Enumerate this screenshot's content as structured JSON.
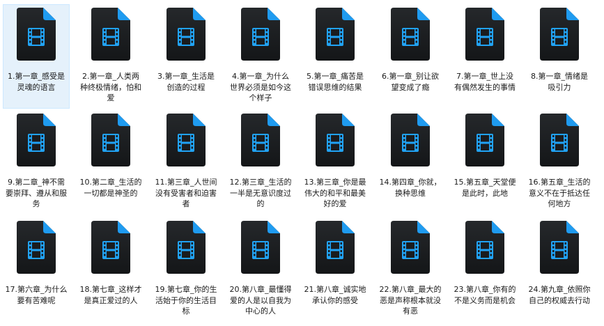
{
  "files": [
    {
      "name": "1.第一章_感受是灵魂的语言",
      "selected": true
    },
    {
      "name": "2.第一章_人类两种终极情绪，怕和爱"
    },
    {
      "name": "3.第一章_生活是创造的过程"
    },
    {
      "name": "4.第一章_为什么世界必须是如今这个样子"
    },
    {
      "name": "5.第一章_痛苦是错误思维的结果"
    },
    {
      "name": "6.第一章_别让欲望变成了瘾"
    },
    {
      "name": "7.第一章_世上没有偶然发生的事情"
    },
    {
      "name": "8.第一章_情绪是吸引力"
    },
    {
      "name": "9.第二章_神不需要崇拜、遵从和服务"
    },
    {
      "name": "10.第二章_生活的一切都是神圣的"
    },
    {
      "name": "11.第三章_人世间没有受害者和迫害者"
    },
    {
      "name": "12.第三章_生活的一半是无意识度过的"
    },
    {
      "name": "13.第三章_你是最伟大的和平和最美好的爱"
    },
    {
      "name": "14.第四章_你就，换种思维"
    },
    {
      "name": "15.第五章_天堂便是此时，此地"
    },
    {
      "name": "16.第五章_生活的意义不在于抵达任何地方"
    },
    {
      "name": "17.第六章_为什么要有苦难呢"
    },
    {
      "name": "18.第七章_这样才是真正爱过的人"
    },
    {
      "name": "19.第七章_你的生活始于你的生活目标"
    },
    {
      "name": "20.第八章_最懂得爱的人是以自我为中心的人"
    },
    {
      "name": "21.第八章_诚实地承认你的感受"
    },
    {
      "name": "22.第八章_最大的恶是声称根本就没有恶"
    },
    {
      "name": "23.第八章_你有的不是义务而是机会"
    },
    {
      "name": "24.第九章_依照你自己的权威去行动"
    }
  ],
  "icon": "video-file-icon",
  "colors": {
    "icon_body": "#1a1c1e",
    "icon_fold": "#1f9bf0",
    "film_glyph": "#21a3f5",
    "selection_bg": "#e5f1fb",
    "selection_border": "#cce8ff"
  }
}
